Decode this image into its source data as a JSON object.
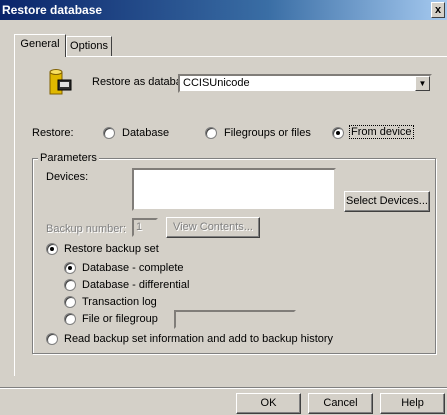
{
  "window": {
    "title": "Restore database",
    "close_glyph": "x"
  },
  "tabs": [
    {
      "label": "General",
      "active": true
    },
    {
      "label": "Options",
      "active": false
    }
  ],
  "restore_as": {
    "label": "Restore as database:",
    "value": "CCISUnicode",
    "icon": "database-icon"
  },
  "restore_from": {
    "label": "Restore:",
    "options": [
      {
        "label": "Database",
        "selected": false
      },
      {
        "label": "Filegroups or files",
        "selected": false
      },
      {
        "label": "From device",
        "selected": true
      }
    ]
  },
  "parameters": {
    "legend": "Parameters",
    "devices_label": "Devices:",
    "select_devices_button": "Select Devices...",
    "backup_number_label": "Backup number:",
    "backup_number_value": "1",
    "view_contents_button": "View Contents...",
    "restore_backup_set": {
      "label": "Restore backup set",
      "selected": true
    },
    "backup_types": [
      {
        "label": "Database - complete",
        "selected": true
      },
      {
        "label": "Database - differential",
        "selected": false
      },
      {
        "label": "Transaction log",
        "selected": false
      },
      {
        "label": "File or filegroup",
        "selected": false
      }
    ],
    "read_backup_info": {
      "label": "Read backup set information and add to backup history",
      "selected": false
    }
  },
  "footer": {
    "ok": "OK",
    "cancel": "Cancel",
    "help": "Help"
  }
}
